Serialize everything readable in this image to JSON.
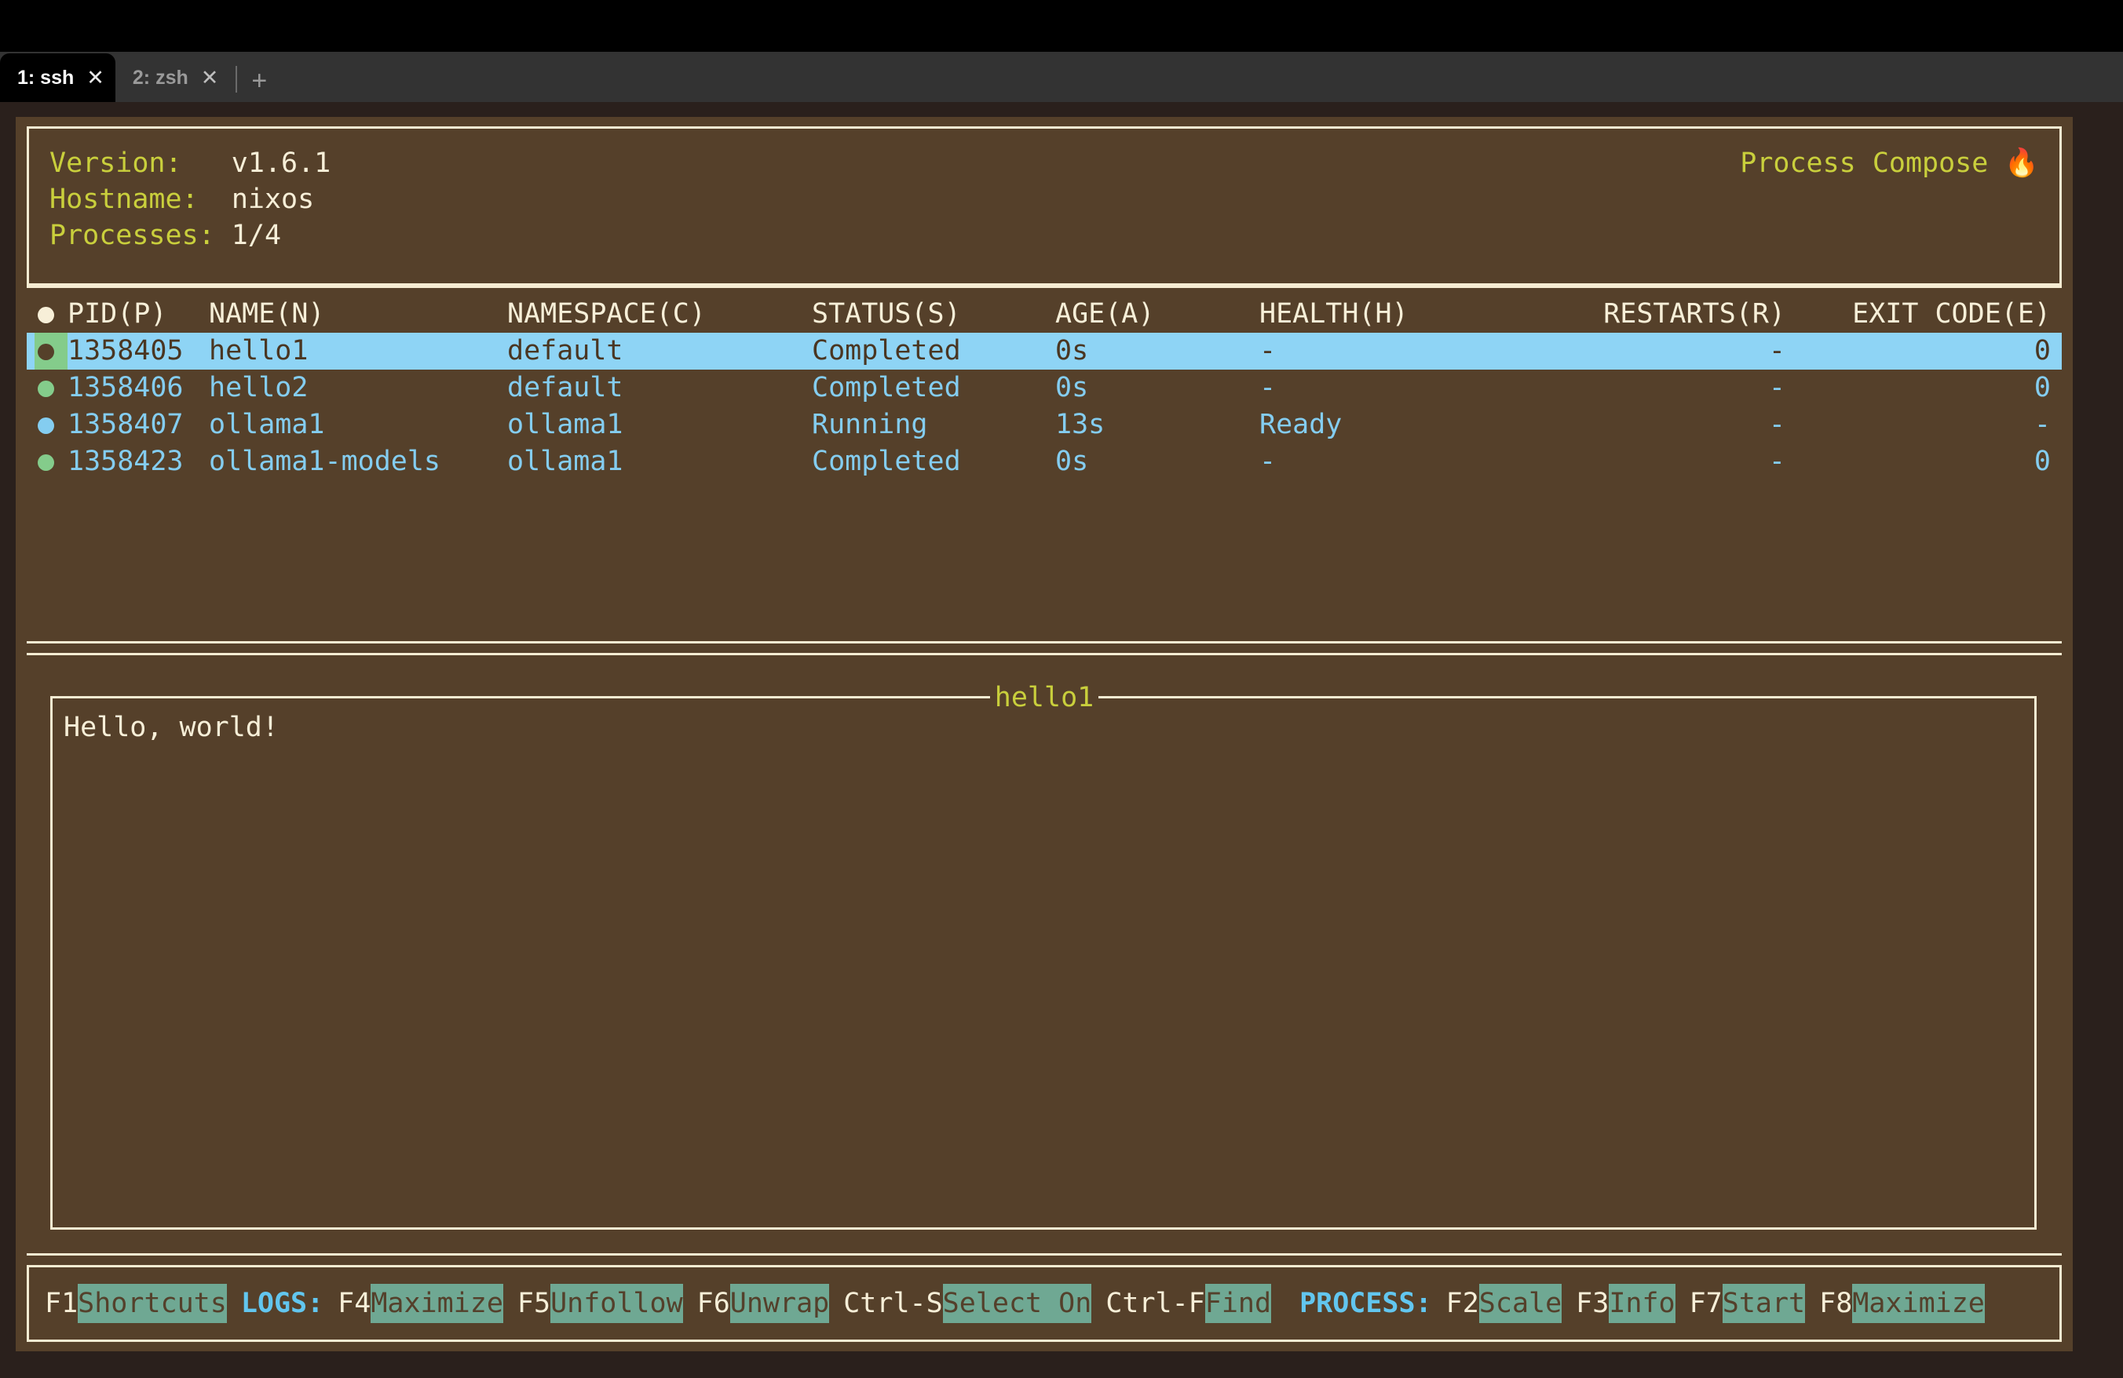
{
  "window": {
    "tabs": [
      {
        "label": "1: ssh",
        "close": "✕",
        "active": true
      },
      {
        "label": "2: zsh",
        "close": "✕",
        "active": false
      }
    ],
    "new_tab": "+"
  },
  "header": {
    "version_label": "Version:",
    "version_value": "v1.6.1",
    "hostname_label": "Hostname:",
    "hostname_value": "nixos",
    "processes_label": "Processes:",
    "processes_value": "1/4",
    "title": "Process Compose",
    "title_icon": "🔥"
  },
  "table": {
    "columns": [
      "PID(P)",
      "NAME(N)",
      "NAMESPACE(C)",
      "STATUS(S)",
      "AGE(A)",
      "HEALTH(H)",
      "RESTARTS(R)",
      "EXIT CODE(E)"
    ],
    "rows": [
      {
        "dot": "green",
        "pid": "1358405",
        "name": "hello1",
        "namespace": "default",
        "status": "Completed",
        "age": "0s",
        "health": "-",
        "restarts": "-",
        "exit_code": "0",
        "selected": true
      },
      {
        "dot": "green",
        "pid": "1358406",
        "name": "hello2",
        "namespace": "default",
        "status": "Completed",
        "age": "0s",
        "health": "-",
        "restarts": "-",
        "exit_code": "0",
        "selected": false
      },
      {
        "dot": "blue",
        "pid": "1358407",
        "name": "ollama1",
        "namespace": "ollama1",
        "status": "Running",
        "age": "13s",
        "health": "Ready",
        "restarts": "-",
        "exit_code": "-",
        "selected": false
      },
      {
        "dot": "green",
        "pid": "1358423",
        "name": "ollama1-models",
        "namespace": "ollama1",
        "status": "Completed",
        "age": "0s",
        "health": "-",
        "restarts": "-",
        "exit_code": "0",
        "selected": false
      }
    ]
  },
  "log_panel": {
    "title": "hello1",
    "lines": [
      "Hello, world!"
    ]
  },
  "footer": {
    "items": [
      {
        "kind": "shortcut",
        "key": "F1",
        "action": "Shortcuts"
      },
      {
        "kind": "group",
        "label": "LOGS:"
      },
      {
        "kind": "shortcut",
        "key": "F4",
        "action": "Maximize"
      },
      {
        "kind": "shortcut",
        "key": "F5",
        "action": "Unfollow"
      },
      {
        "kind": "shortcut",
        "key": "F6",
        "action": "Unwrap"
      },
      {
        "kind": "shortcut",
        "key": "Ctrl-S",
        "action": "Select On"
      },
      {
        "kind": "shortcut",
        "key": "Ctrl-F",
        "action": "Find"
      },
      {
        "kind": "group",
        "label": "PROCESS:"
      },
      {
        "kind": "shortcut",
        "key": "F2",
        "action": "Scale"
      },
      {
        "kind": "shortcut",
        "key": "F3",
        "action": "Info"
      },
      {
        "kind": "shortcut",
        "key": "F7",
        "action": "Start"
      },
      {
        "kind": "shortcut",
        "key": "F8",
        "action": "Maximize"
      }
    ]
  },
  "colors": {
    "background": "#55402a",
    "outer": "#2a201c",
    "border": "#f5ecd2",
    "accent_yellow": "#c9cf3c",
    "accent_blue": "#84cdf0",
    "selection": "#8ed4f5",
    "highlight": "#6fa893",
    "dot_green": "#84cc8b",
    "dot_blue": "#84cdf0",
    "text": "#f7efd8"
  }
}
